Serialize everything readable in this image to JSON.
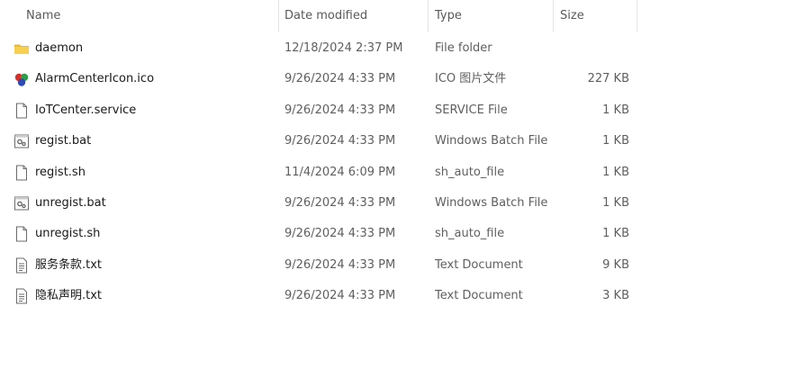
{
  "columns": {
    "name": "Name",
    "date": "Date modified",
    "type": "Type",
    "size": "Size"
  },
  "sort_indicator": "^",
  "files": [
    {
      "name": "daemon",
      "date": "12/18/2024 2:37 PM",
      "type": "File folder",
      "size": "",
      "icon": "folder-icon"
    },
    {
      "name": "AlarmCenterIcon.ico",
      "date": "9/26/2024 4:33 PM",
      "type": "ICO 图片文件",
      "size": "227 KB",
      "icon": "ico-image-icon"
    },
    {
      "name": "IoTCenter.service",
      "date": "9/26/2024 4:33 PM",
      "type": "SERVICE File",
      "size": "1 KB",
      "icon": "blank-file-icon"
    },
    {
      "name": "regist.bat",
      "date": "9/26/2024 4:33 PM",
      "type": "Windows Batch File",
      "size": "1 KB",
      "icon": "batch-file-icon"
    },
    {
      "name": "regist.sh",
      "date": "11/4/2024 6:09 PM",
      "type": "sh_auto_file",
      "size": "1 KB",
      "icon": "blank-file-icon"
    },
    {
      "name": "unregist.bat",
      "date": "9/26/2024 4:33 PM",
      "type": "Windows Batch File",
      "size": "1 KB",
      "icon": "batch-file-icon"
    },
    {
      "name": "unregist.sh",
      "date": "9/26/2024 4:33 PM",
      "type": "sh_auto_file",
      "size": "1 KB",
      "icon": "blank-file-icon"
    },
    {
      "name": "服务条款.txt",
      "date": "9/26/2024 4:33 PM",
      "type": "Text Document",
      "size": "9 KB",
      "icon": "text-file-icon"
    },
    {
      "name": "隐私声明.txt",
      "date": "9/26/2024 4:33 PM",
      "type": "Text Document",
      "size": "3 KB",
      "icon": "text-file-icon"
    }
  ]
}
